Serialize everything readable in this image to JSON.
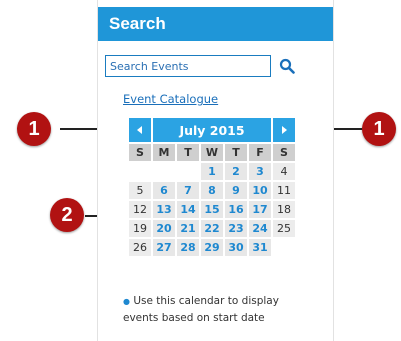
{
  "panel": {
    "title": "Search"
  },
  "search": {
    "placeholder": "Search Events",
    "button_icon": "search-icon"
  },
  "catalogue_link": "Event Catalogue",
  "calendar": {
    "month_label": "July 2015",
    "prev_icon": "triangle-left-icon",
    "next_icon": "triangle-right-icon",
    "weekdays": [
      "S",
      "M",
      "T",
      "W",
      "T",
      "F",
      "S"
    ],
    "weeks": [
      [
        "",
        "",
        "",
        "1",
        "2",
        "3",
        "4"
      ],
      [
        "5",
        "6",
        "7",
        "8",
        "9",
        "10",
        "11"
      ],
      [
        "12",
        "13",
        "14",
        "15",
        "16",
        "17",
        "18"
      ],
      [
        "19",
        "20",
        "21",
        "22",
        "23",
        "24",
        "25"
      ],
      [
        "26",
        "27",
        "28",
        "29",
        "30",
        "31",
        ""
      ]
    ]
  },
  "note": "Use this calendar to display events based on start date",
  "callouts": {
    "marker_1": "1",
    "marker_2": "2"
  },
  "colors": {
    "header": "#1f96d8",
    "calendar_header": "#2ba3e3",
    "link": "#1e88d0",
    "marker": "#b11212"
  }
}
